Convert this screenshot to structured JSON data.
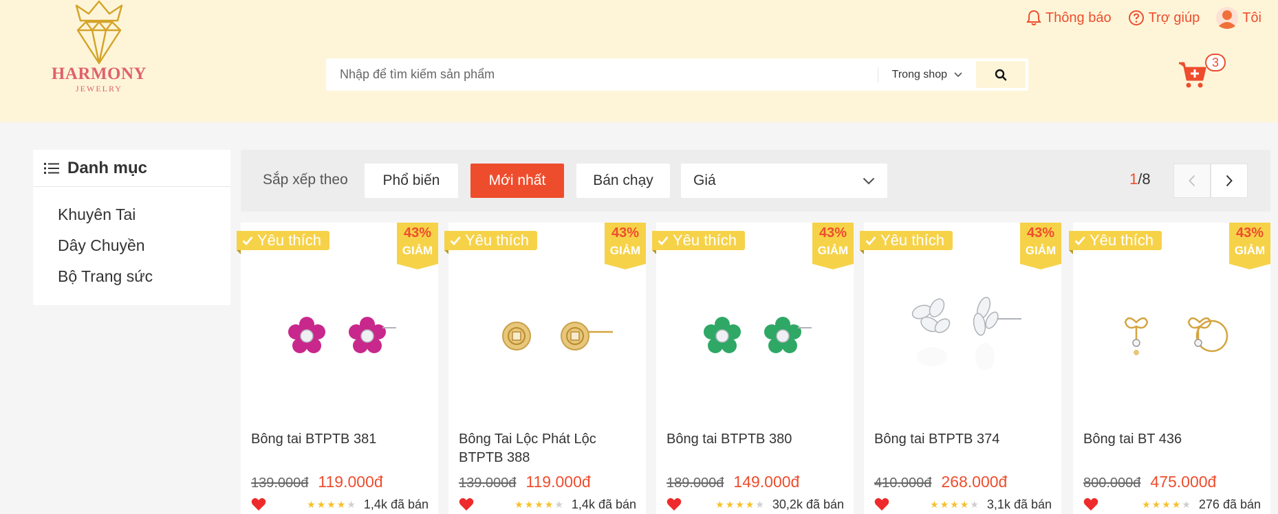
{
  "brand": {
    "name": "HARMONY",
    "sub": "JEWELRY"
  },
  "top_links": {
    "notifications": "Thông báo",
    "help": "Trợ giúp",
    "account": "Tôi"
  },
  "search": {
    "placeholder": "Nhập để tìm kiếm sản phẩm",
    "scope": "Trong shop"
  },
  "cart": {
    "count": "3"
  },
  "sidebar": {
    "title": "Danh mục",
    "items": [
      {
        "label": "Khuyên Tai"
      },
      {
        "label": "Dây Chuyền"
      },
      {
        "label": "Bộ Trang sức"
      }
    ]
  },
  "sortbar": {
    "label": "Sắp xếp theo",
    "options": [
      {
        "label": "Phổ biến"
      },
      {
        "label": "Mới nhất"
      },
      {
        "label": "Bán chạy"
      }
    ],
    "active": "Mới nhất",
    "price_select": "Giá",
    "page_current": "1",
    "page_total": "/8"
  },
  "colors": {
    "accent": "#ee4d2d",
    "header_bg": "#fef5d9",
    "ribbon": "#f6d249"
  },
  "products": [
    {
      "badge": "Yêu thích",
      "discount": "43%",
      "discount_label": "GIẢM",
      "name": "Bông tai BTPTB 381",
      "old_price": "139.000đ",
      "price": "119.000đ",
      "rating": 4,
      "sold": "1,4k đã bán",
      "image": "pink-flower-earrings"
    },
    {
      "badge": "Yêu thích",
      "discount": "43%",
      "discount_label": "GIẢM",
      "name": "Bông Tai Lộc Phát Lộc BTPTB 388",
      "old_price": "139.000đ",
      "price": "119.000đ",
      "rating": 4,
      "sold": "1,4k đã bán",
      "image": "gold-coin-earrings"
    },
    {
      "badge": "Yêu thích",
      "discount": "43%",
      "discount_label": "GIẢM",
      "name": "Bông tai BTPTB 380",
      "old_price": "189.000đ",
      "price": "149.000đ",
      "rating": 4,
      "sold": "30,2k đã bán",
      "image": "green-flower-earrings"
    },
    {
      "badge": "Yêu thích",
      "discount": "43%",
      "discount_label": "GIẢM",
      "name": "Bông tai BTPTB 374",
      "old_price": "410.000đ",
      "price": "268.000đ",
      "rating": 4,
      "sold": "3,1k đã bán",
      "image": "silver-leaf-earrings"
    },
    {
      "badge": "Yêu thích",
      "discount": "43%",
      "discount_label": "GIẢM",
      "name": "Bông tai BT 436",
      "old_price": "800.000đ",
      "price": "475.000đ",
      "rating": 4,
      "sold": "276 đã bán",
      "image": "gold-bow-earrings"
    }
  ]
}
